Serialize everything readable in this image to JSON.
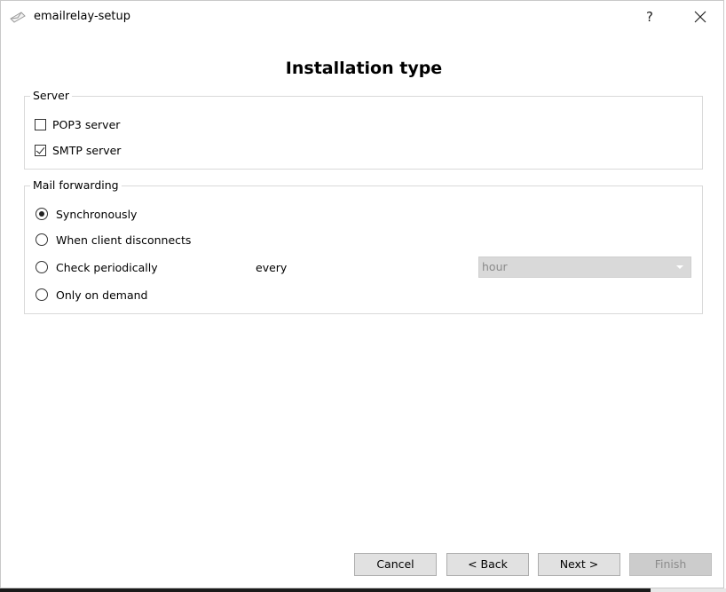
{
  "window": {
    "title": "emailrelay-setup",
    "help": "?"
  },
  "page": {
    "title": "Installation type"
  },
  "server_group": {
    "legend": "Server",
    "pop3": {
      "label": "POP3 server",
      "checked": false
    },
    "smtp": {
      "label": "SMTP server",
      "checked": true
    }
  },
  "forwarding_group": {
    "legend": "Mail forwarding",
    "options": [
      {
        "label": "Synchronously",
        "selected": true
      },
      {
        "label": "When client disconnects",
        "selected": false
      },
      {
        "label": "Check periodically",
        "selected": false
      },
      {
        "label": "Only on demand",
        "selected": false
      }
    ],
    "every_label": "every",
    "interval": {
      "value": "hour",
      "disabled": true
    }
  },
  "buttons": {
    "cancel": "Cancel",
    "back": "< Back",
    "next": "Next >",
    "finish": "Finish"
  }
}
